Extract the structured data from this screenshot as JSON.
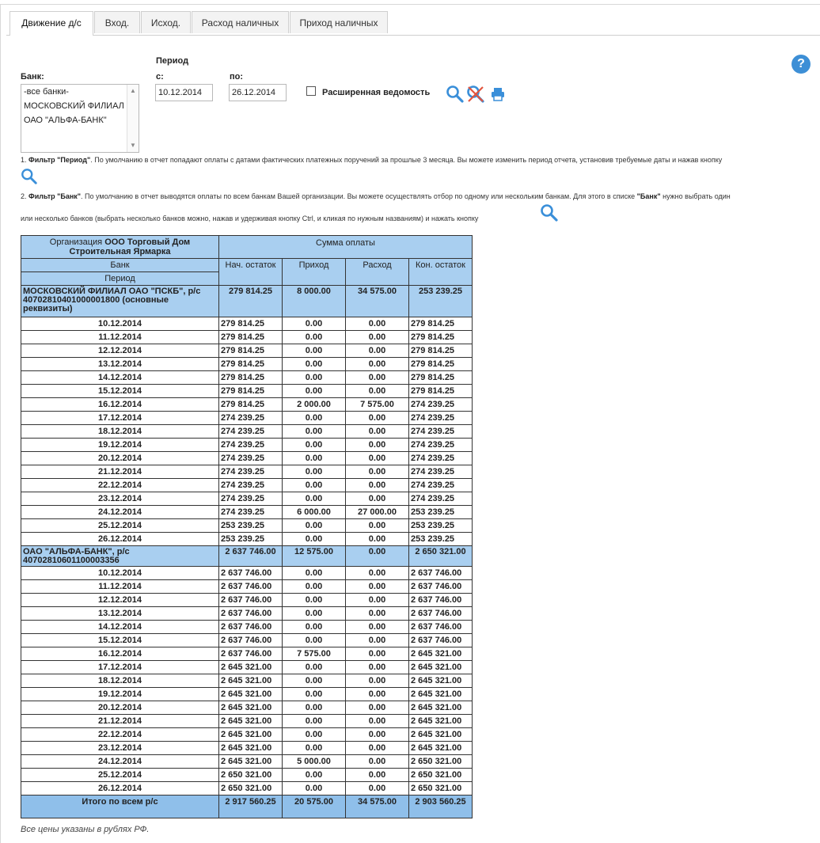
{
  "tabs": [
    "Движение д/с",
    "Вход.",
    "Исход.",
    "Расход наличных",
    "Приход наличных"
  ],
  "filter": {
    "period_label": "Период",
    "bank_label": "Банк:",
    "from_label": "с:",
    "to_label": "по:",
    "bank_options": [
      "-все банки-",
      "МОСКОВСКИЙ ФИЛИАЛ",
      "ОАО \"АЛЬФА-БАНК\""
    ],
    "date_from": "10.12.2014",
    "date_to": "26.12.2014",
    "extended_label": "Расширенная ведомость",
    "help_label": "?"
  },
  "info": {
    "line1_num": "1. ",
    "line1_bold": "Фильтр \"Период\"",
    "line1_text": ". По умолчанию в отчет попадают оплаты с датами фактических платежных поручений за прошлые 3 месяца. Вы можете изменить период отчета, установив требуемые даты и нажав кнопку",
    "line2_num": "2. ",
    "line2_bold": "Фильтр \"Банк\"",
    "line2_text": ". По умолчанию в отчет выводятся оплаты по всем банкам Вашей организации. Вы можете осуществлять отбор по одному или нескольким банкам. Для этого в списке ",
    "line2_bold2": "\"Банк\"",
    "line2_text2": " нужно выбрать один",
    "line3_text": "или несколько банков (выбрать несколько банков можно, нажав и удерживая кнопку Ctrl, и кликая по нужным названиям) и нажать кнопку"
  },
  "table": {
    "org_prefix": "Организация ",
    "org_name": "ООО Торговый Дом Строительная Ярмарка",
    "sum_header": "Сумма оплаты",
    "bank_header": "Банк",
    "period_header": "Период",
    "col_headers": [
      "Нач. остаток",
      "Приход",
      "Расход",
      "Кон. остаток"
    ],
    "groups": [
      {
        "name": "МОСКОВСКИЙ ФИЛИАЛ ОАО \"ПСКБ\", р/с 40702810401000001800 (основные реквизиты)",
        "totals": [
          "279 814.25",
          "8 000.00",
          "34 575.00",
          "253 239.25"
        ],
        "rows": [
          [
            "10.12.2014",
            "279 814.25",
            "0.00",
            "0.00",
            "279 814.25"
          ],
          [
            "11.12.2014",
            "279 814.25",
            "0.00",
            "0.00",
            "279 814.25"
          ],
          [
            "12.12.2014",
            "279 814.25",
            "0.00",
            "0.00",
            "279 814.25"
          ],
          [
            "13.12.2014",
            "279 814.25",
            "0.00",
            "0.00",
            "279 814.25"
          ],
          [
            "14.12.2014",
            "279 814.25",
            "0.00",
            "0.00",
            "279 814.25"
          ],
          [
            "15.12.2014",
            "279 814.25",
            "0.00",
            "0.00",
            "279 814.25"
          ],
          [
            "16.12.2014",
            "279 814.25",
            "2 000.00",
            "7 575.00",
            "274 239.25"
          ],
          [
            "17.12.2014",
            "274 239.25",
            "0.00",
            "0.00",
            "274 239.25"
          ],
          [
            "18.12.2014",
            "274 239.25",
            "0.00",
            "0.00",
            "274 239.25"
          ],
          [
            "19.12.2014",
            "274 239.25",
            "0.00",
            "0.00",
            "274 239.25"
          ],
          [
            "20.12.2014",
            "274 239.25",
            "0.00",
            "0.00",
            "274 239.25"
          ],
          [
            "21.12.2014",
            "274 239.25",
            "0.00",
            "0.00",
            "274 239.25"
          ],
          [
            "22.12.2014",
            "274 239.25",
            "0.00",
            "0.00",
            "274 239.25"
          ],
          [
            "23.12.2014",
            "274 239.25",
            "0.00",
            "0.00",
            "274 239.25"
          ],
          [
            "24.12.2014",
            "274 239.25",
            "6 000.00",
            "27 000.00",
            "253 239.25"
          ],
          [
            "25.12.2014",
            "253 239.25",
            "0.00",
            "0.00",
            "253 239.25"
          ],
          [
            "26.12.2014",
            "253 239.25",
            "0.00",
            "0.00",
            "253 239.25"
          ]
        ]
      },
      {
        "name": "ОАО \"АЛЬФА-БАНК\", р/с 40702810601100003356",
        "totals": [
          "2 637 746.00",
          "12 575.00",
          "0.00",
          "2 650 321.00"
        ],
        "rows": [
          [
            "10.12.2014",
            "2 637 746.00",
            "0.00",
            "0.00",
            "2 637 746.00"
          ],
          [
            "11.12.2014",
            "2 637 746.00",
            "0.00",
            "0.00",
            "2 637 746.00"
          ],
          [
            "12.12.2014",
            "2 637 746.00",
            "0.00",
            "0.00",
            "2 637 746.00"
          ],
          [
            "13.12.2014",
            "2 637 746.00",
            "0.00",
            "0.00",
            "2 637 746.00"
          ],
          [
            "14.12.2014",
            "2 637 746.00",
            "0.00",
            "0.00",
            "2 637 746.00"
          ],
          [
            "15.12.2014",
            "2 637 746.00",
            "0.00",
            "0.00",
            "2 637 746.00"
          ],
          [
            "16.12.2014",
            "2 637 746.00",
            "7 575.00",
            "0.00",
            "2 645 321.00"
          ],
          [
            "17.12.2014",
            "2 645 321.00",
            "0.00",
            "0.00",
            "2 645 321.00"
          ],
          [
            "18.12.2014",
            "2 645 321.00",
            "0.00",
            "0.00",
            "2 645 321.00"
          ],
          [
            "19.12.2014",
            "2 645 321.00",
            "0.00",
            "0.00",
            "2 645 321.00"
          ],
          [
            "20.12.2014",
            "2 645 321.00",
            "0.00",
            "0.00",
            "2 645 321.00"
          ],
          [
            "21.12.2014",
            "2 645 321.00",
            "0.00",
            "0.00",
            "2 645 321.00"
          ],
          [
            "22.12.2014",
            "2 645 321.00",
            "0.00",
            "0.00",
            "2 645 321.00"
          ],
          [
            "23.12.2014",
            "2 645 321.00",
            "0.00",
            "0.00",
            "2 645 321.00"
          ],
          [
            "24.12.2014",
            "2 645 321.00",
            "5 000.00",
            "0.00",
            "2 650 321.00"
          ],
          [
            "25.12.2014",
            "2 650 321.00",
            "0.00",
            "0.00",
            "2 650 321.00"
          ],
          [
            "26.12.2014",
            "2 650 321.00",
            "0.00",
            "0.00",
            "2 650 321.00"
          ]
        ]
      }
    ],
    "total_label": "Итого по всем р/с",
    "total_values": [
      "2 917 560.25",
      "20 575.00",
      "34 575.00",
      "2 903 560.25"
    ]
  },
  "footnote": "Все цены указаны в рублях РФ."
}
